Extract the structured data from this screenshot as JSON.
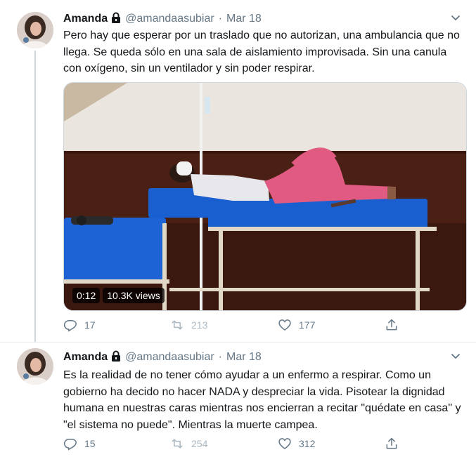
{
  "tweets": [
    {
      "name": "Amanda",
      "handle": "@amandaasubiar",
      "separator": "·",
      "date": "Mar 18",
      "text": "Pero hay que esperar por un traslado que no autorizan, una ambulancia que no llega. Se queda sólo en una sala de aislamiento improvisada. Sin una canula con oxígeno, sin un ventilador y sin poder respirar.",
      "video": {
        "duration": "0:12",
        "views": "10.3K views"
      },
      "replies": "17",
      "retweets": "213",
      "likes": "177"
    },
    {
      "name": "Amanda",
      "handle": "@amandaasubiar",
      "separator": "·",
      "date": "Mar 18",
      "text": "Es la realidad de no tener cómo ayudar a un enfermo a respirar. Como un gobierno ha decido no hacer NADA y despreciar la vida. Pisotear la dignidad humana en nuestras caras mientras nos encierran a recitar \"quédate en casa\" y \"el sistema no puede\". Mientras la muerte campea.",
      "replies": "15",
      "retweets": "254",
      "likes": "312"
    }
  ],
  "icons": {
    "lock": "lock-icon",
    "caret": "chevron-down-icon",
    "reply": "reply-icon",
    "retweet": "retweet-icon",
    "like": "heart-icon",
    "share": "share-icon"
  },
  "colors": {
    "text": "#14171a",
    "secondary": "#657786",
    "border": "#e6ecf0",
    "thread_line": "#ccd6dd"
  }
}
